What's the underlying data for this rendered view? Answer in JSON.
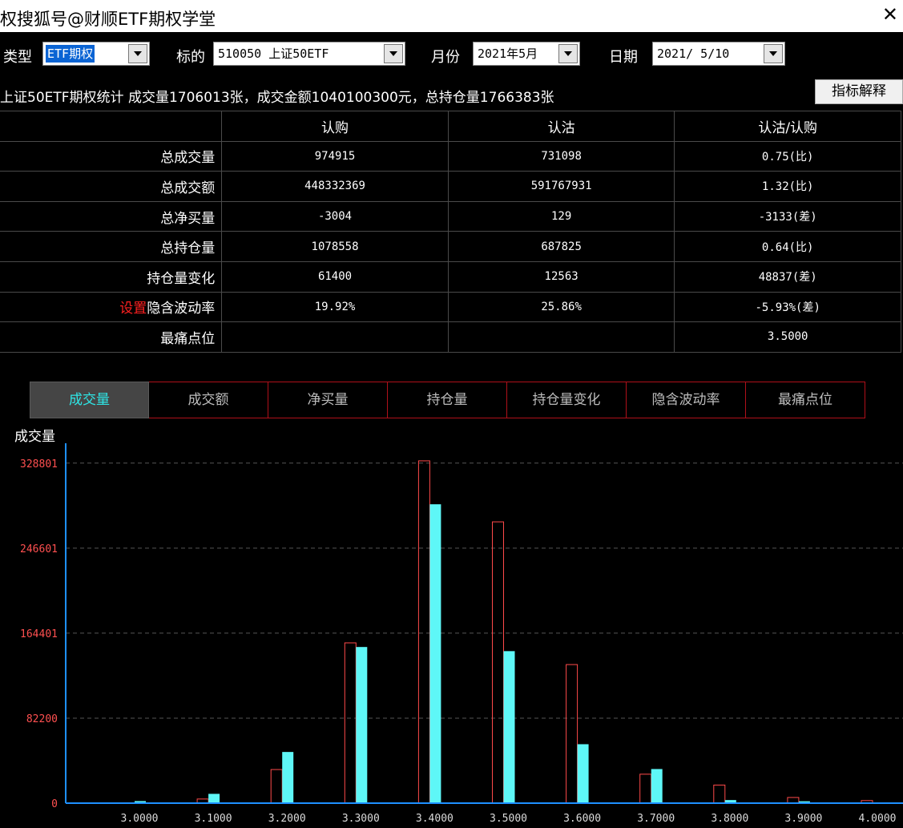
{
  "window": {
    "title": "权搜狐号@财顺ETF期权学堂"
  },
  "filters": {
    "type_label": "类型",
    "type_value": "ETF期权",
    "underlying_label": "标的",
    "underlying_value": "510050 上证50ETF",
    "month_label": "月份",
    "month_value": "2021年5月",
    "date_label": "日期",
    "date_value": "2021/ 5/10"
  },
  "summary": "上证50ETF期权统计 成交量1706013张，成交金额1040100300元，总持仓量1766383张",
  "explain_button": "指标解释",
  "table": {
    "headers": [
      "",
      "认购",
      "认沽",
      "认沽/认购"
    ],
    "settings_label": "设置",
    "rows": [
      {
        "label": "总成交量",
        "call": "974915",
        "put": "731098",
        "ratio": "0.75(比)"
      },
      {
        "label": "总成交额",
        "call": "448332369",
        "put": "591767931",
        "ratio": "1.32(比)"
      },
      {
        "label": "总净买量",
        "call": "-3004",
        "put": "129",
        "ratio": "-3133(差)"
      },
      {
        "label": "总持仓量",
        "call": "1078558",
        "put": "687825",
        "ratio": "0.64(比)"
      },
      {
        "label": "持仓量变化",
        "call": "61400",
        "put": "12563",
        "ratio": "48837(差)"
      },
      {
        "label": "隐含波动率",
        "call": "19.92%",
        "put": "25.86%",
        "ratio": "-5.93%(差)"
      },
      {
        "label": "最痛点位",
        "call": "",
        "put": "",
        "ratio": "3.5000"
      }
    ]
  },
  "tabs": [
    "成交量",
    "成交额",
    "净买量",
    "持仓量",
    "持仓量变化",
    "隐含波动率",
    "最痛点位"
  ],
  "active_tab": 0,
  "colors": {
    "call": "#ff4a4a",
    "put": "#5ef7f7",
    "axis": "#1e90ff",
    "ytick": "#ff5050",
    "tab_border": "#b0101a"
  },
  "chart_data": {
    "type": "bar",
    "ylabel": "成交量",
    "categories": [
      "3.0000",
      "3.1000",
      "3.2000",
      "3.3000",
      "3.4000",
      "3.5000",
      "3.6000",
      "3.7000",
      "3.8000",
      "3.9000",
      "4.0000"
    ],
    "yticks": [
      "0",
      "82200",
      "164401",
      "246601",
      "328801"
    ],
    "ylim": [
      0,
      348000
    ],
    "grid": true,
    "series": [
      {
        "style": "outline",
        "values": [
          400,
          4000,
          32500,
          155000,
          331000,
          272000,
          134000,
          28000,
          17500,
          5500,
          2500
        ]
      },
      {
        "style": "filled",
        "values": [
          2000,
          9000,
          49500,
          151000,
          289000,
          147000,
          57000,
          33000,
          3000,
          1800,
          700
        ]
      }
    ]
  }
}
